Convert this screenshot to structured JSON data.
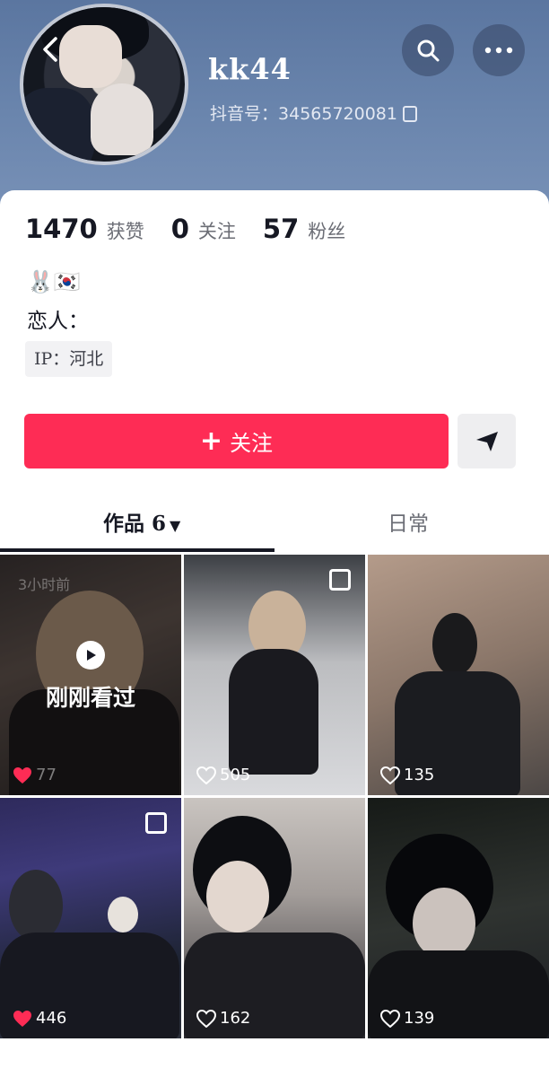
{
  "profile": {
    "username": "kk44",
    "douyin_id_label": "抖音号：",
    "douyin_id": "34565720081",
    "emojis": "🐰🇰🇷",
    "bio": "恋人：",
    "ip": "IP：河北"
  },
  "stats": [
    {
      "num": "1470",
      "label": "获赞"
    },
    {
      "num": "0",
      "label": "关注"
    },
    {
      "num": "57",
      "label": "粉丝"
    }
  ],
  "actions": {
    "follow_label": "关注"
  },
  "tabs": {
    "works_label": "作品 6",
    "daily_label": "日常"
  },
  "videos": [
    {
      "likes": "77",
      "liked": true,
      "time": "3小时前",
      "overlay_text": "刚刚看过"
    },
    {
      "likes": "505",
      "liked": false
    },
    {
      "likes": "135",
      "liked": false
    },
    {
      "likes": "446",
      "liked": true
    },
    {
      "likes": "162",
      "liked": false
    },
    {
      "likes": "139",
      "liked": false
    }
  ],
  "colors": {
    "accent": "#fe2c55",
    "header_bg": "#6a85ad"
  },
  "icons": [
    "back-icon",
    "search-icon",
    "more-icon",
    "copy-icon",
    "share-icon",
    "play-icon",
    "heart-icon",
    "caret-down-icon"
  ]
}
